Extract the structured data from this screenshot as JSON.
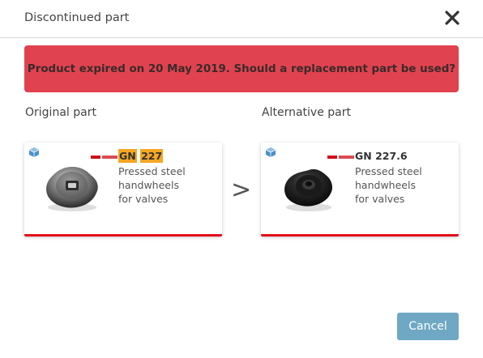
{
  "dialog": {
    "title": "Discontinued part",
    "close_icon": "close-icon"
  },
  "alert": {
    "message": "Product expired on 20 May 2019. Should a replacement part be used?",
    "color": "#e0434f"
  },
  "original": {
    "heading": "Original part",
    "code_prefix": "GN",
    "code_number": "227",
    "description_lines": [
      "Pressed steel",
      "handwheels",
      "for valves"
    ],
    "icon": "3d-cube-icon",
    "brand_logo": "ganter-logo"
  },
  "separator": ">",
  "alternative": {
    "heading": "Alternative part",
    "code": "GN 227.6",
    "description_lines": [
      "Pressed steel",
      "handwheels",
      "for valves"
    ],
    "icon": "3d-cube-icon",
    "brand_logo": "ganter-logo"
  },
  "footer": {
    "cancel_label": "Cancel"
  },
  "colors": {
    "highlight": "#f5a623",
    "card_bar": "#e3101a",
    "button": "#6fa8c4",
    "cube_icon": "#4a90c8"
  }
}
